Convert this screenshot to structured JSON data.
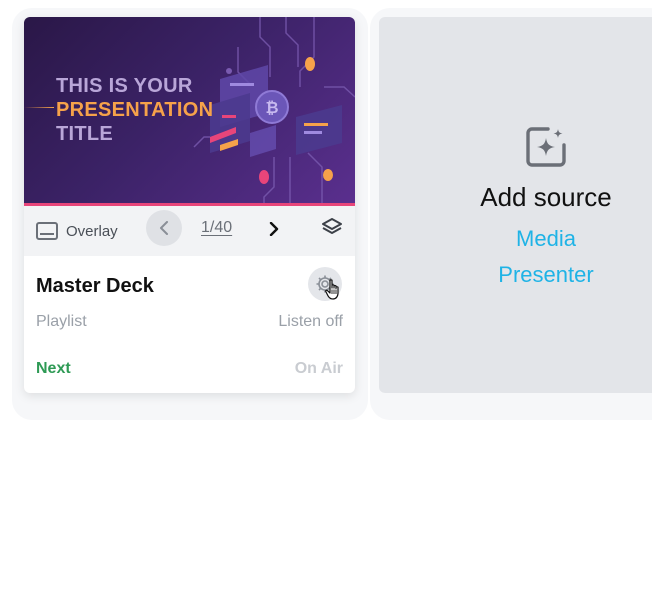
{
  "source_card": {
    "thumbnail": {
      "title_line1": "THIS IS YOUR",
      "title_line2": "PRESENTATION",
      "title_line3": "TITLE"
    },
    "toolbar": {
      "overlay_label": "Overlay",
      "page_counter": "1/40"
    },
    "deck_title": "Master Deck",
    "type_label": "Playlist",
    "listen_label": "Listen off",
    "next_label": "Next",
    "on_air_label": "On Air"
  },
  "add_source": {
    "title": "Add source",
    "options": [
      "Media",
      "Presenter"
    ]
  },
  "colors": {
    "next_green": "#2e9a55",
    "link_blue": "#1fb3e6",
    "thumb_accent_orange": "#f6a24a",
    "thumb_accent_pink": "#e8457a"
  }
}
